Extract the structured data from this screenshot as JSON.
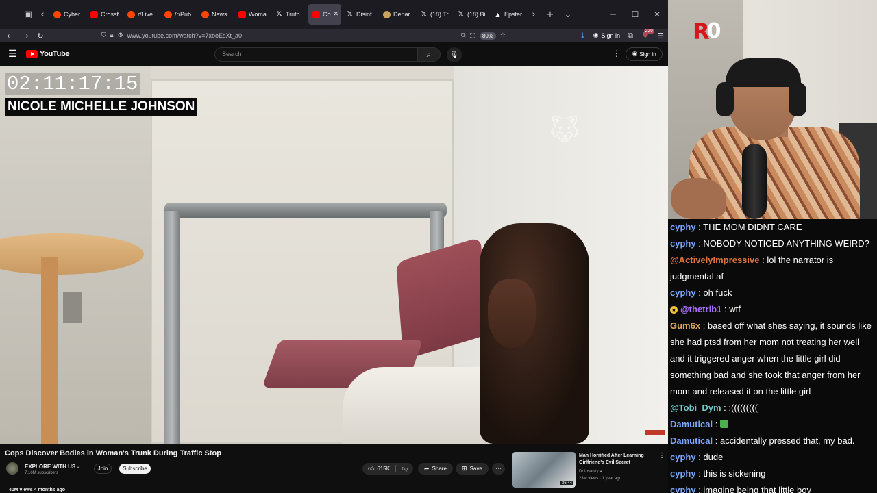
{
  "browser": {
    "tabs": [
      {
        "label": "Cyber",
        "fav": "reddit"
      },
      {
        "label": "Crossf",
        "fav": "yt"
      },
      {
        "label": "r/Live",
        "fav": "reddit"
      },
      {
        "label": "/r/Pub",
        "fav": "reddit"
      },
      {
        "label": "News",
        "fav": "reddit"
      },
      {
        "label": "Woma",
        "fav": "yt"
      },
      {
        "label": "Truth",
        "fav": "x"
      },
      {
        "label": "Co",
        "fav": "yt"
      },
      {
        "label": "Disinf",
        "fav": "x"
      },
      {
        "label": "Depar",
        "fav": "glob"
      },
      {
        "label": "(18) Tr",
        "fav": "x"
      },
      {
        "label": "(18) Bi",
        "fav": "x"
      },
      {
        "label": "Epster",
        "fav": "arc"
      }
    ],
    "url": "www.youtube.com/watch?v=7xboEsXt_a0",
    "zoom": "80%",
    "signin_label": "Sign in",
    "notif_count": "229"
  },
  "youtube": {
    "logo_text": "YouTube",
    "search_placeholder": "Search",
    "signin_label": "Sign in",
    "video": {
      "timestamp_overlay": "02:11:17:15",
      "name_overlay": "NICOLE MICHELLE JOHNSON"
    },
    "title": "Cops Discover Bodies in Woman's Trunk During Traffic Stop",
    "channel": {
      "name": "EXPLORE WITH US",
      "verified": "✔",
      "subscribers": "7.16M subscribers",
      "join_label": "Join",
      "subscribe_label": "Subscribe"
    },
    "actions": {
      "likes": "615K",
      "share_label": "Share",
      "save_label": "Save"
    },
    "views_line": "40M views  4 months ago",
    "recommended": {
      "title": "Man Horrified After Learning Girlfriend's Evil Secret",
      "channel": "Dr Insanity",
      "meta": "23M views · 1 year ago",
      "duration": "36:44"
    }
  },
  "stream": {
    "logo_r": "R",
    "logo_zero": "0"
  },
  "chat": {
    "messages": [
      {
        "user": "cyphy",
        "color": "#7aa7ff",
        "text": " : THE MOM DIDNT CARE"
      },
      {
        "user": "cyphy",
        "color": "#7aa7ff",
        "text": " : NOBODY NOTICED ANYTHING WEIRD?"
      },
      {
        "user": "@ActivelyImpressive",
        "color": "#e0733f",
        "text": " : lol the narrator is judgmental af"
      },
      {
        "user": "cyphy",
        "color": "#7aa7ff",
        "text": " : oh fuck"
      },
      {
        "user": "@thetrib1",
        "color": "#a970ff",
        "text": " : wtf",
        "badge": true
      },
      {
        "user": "Gum6x",
        "color": "#e0a85a",
        "text": " : based off what shes saying, it sounds like she had ptsd from her mom not treating her well and it triggered anger when the little girl did something bad and she took that anger from her mom and released it on the little girl"
      },
      {
        "user": "@Tobi_Dym",
        "color": "#6fc7c7",
        "text": " : :((((((((("
      },
      {
        "user": "Damutical",
        "color": "#7aa7ff",
        "text": " :",
        "emote": true
      },
      {
        "user": "Damutical",
        "color": "#7aa7ff",
        "text": " : accidentally pressed that, my bad."
      },
      {
        "user": "cyphy",
        "color": "#7aa7ff",
        "text": " : dude"
      },
      {
        "user": "cyphy",
        "color": "#7aa7ff",
        "text": " : this is sickening"
      },
      {
        "user": "cyphy",
        "color": "#7aa7ff",
        "text": " : imagine being that little boy"
      }
    ]
  }
}
